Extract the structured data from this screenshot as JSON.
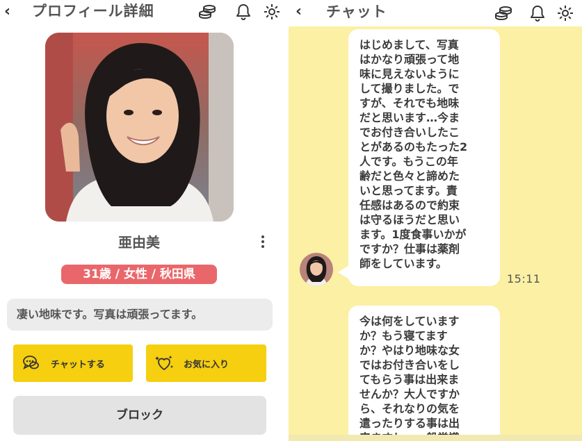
{
  "profile_screen": {
    "back_glyph": "‹",
    "title": "プロフィール詳細",
    "user_name": "亜由美",
    "info_badge": "31歳 / 女性 / 秋田県",
    "bio": "凄い地味です。写真は頑張ってます。",
    "chat_button_label": "チャットする",
    "favorite_button_label": "お気に入り",
    "block_button_label": "ブロック",
    "header_icons": [
      "coins-icon",
      "bell-icon",
      "gear-icon"
    ]
  },
  "chat_screen": {
    "back_glyph": "‹",
    "title": "チャット",
    "header_icons": [
      "coins-icon",
      "bell-icon",
      "gear-icon"
    ],
    "messages": [
      {
        "lines": [
          "はじめまして、写真",
          "はかなり頑張って地",
          "味に見えないように",
          "して撮りました。で",
          "すが、それでも地味",
          "だと思います…今ま",
          "でお付き合いしたこ",
          "とがあるのもたった2",
          "人です。もうこの年",
          "齢だと色々と諦めた",
          "いと思ってます。責",
          "任感はあるので約束",
          "は守るほうだと思い",
          "ます。1度食事いかが",
          "ですか？仕事は薬剤",
          "師をしています。"
        ],
        "time": "15:11"
      },
      {
        "lines": [
          "今は何をしています",
          "か？もう寝てます",
          "か？やはり地味な女",
          "ではお付き合いをし",
          "てもらう事は出来ま",
          "せんか？大人ですか",
          "ら、それなりの気を",
          "遣ったりする事は出",
          "来ますし、一般常識"
        ]
      }
    ]
  },
  "colors": {
    "accent_yellow": "#f5cf10",
    "badge_pink": "#e9676b",
    "chat_background": "#fbf0a4"
  }
}
